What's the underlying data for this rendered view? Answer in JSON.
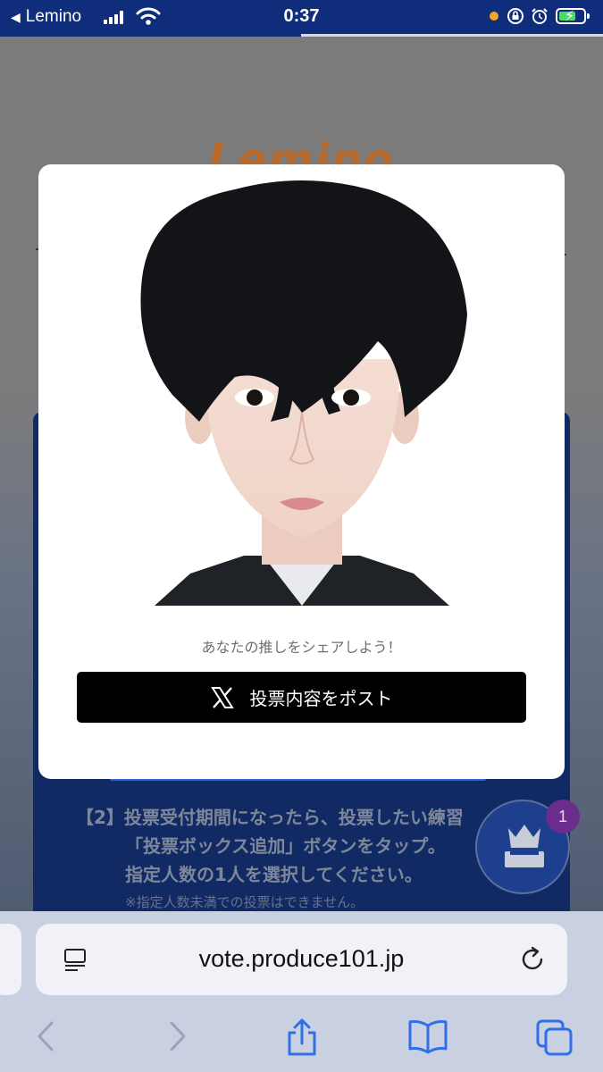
{
  "status_bar": {
    "back_app": "Lemino",
    "time": "0:37"
  },
  "background_page": {
    "logo_text": "Lemino",
    "step2_text_line1": "【2】投票受付期間になったら、投票したい練習",
    "step2_text_line2": "「投票ボックス追加」ボタンをタップ。",
    "step2_text_line3": "指定人数の1人を選択してください。",
    "step2_note": "※指定人数未満での投票はできません。"
  },
  "vote_fab": {
    "badge_count": "1",
    "icon": "crown-ballot-box-icon"
  },
  "modal": {
    "share_text": "あなたの推しをシェアしよう！",
    "post_button_label": "投票内容をポスト",
    "post_button_icon": "x-logo-icon"
  },
  "browser": {
    "url": "vote.produce101.jp",
    "toolbar": [
      "back-icon",
      "forward-icon",
      "share-icon",
      "bookmarks-icon",
      "tabs-icon"
    ]
  },
  "colors": {
    "status_bar": "#0f2d7a",
    "modal_bg": "#ffffff",
    "post_button": "#000000",
    "fab_bg": "#1e3f8e",
    "badge": "#6a2d8c",
    "toolbar_icon": "#2f6fe8"
  }
}
